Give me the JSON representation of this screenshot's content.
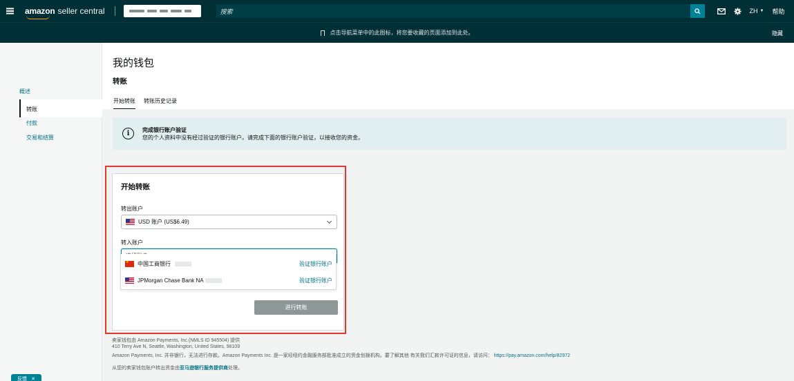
{
  "topbar": {
    "logo_amazon": "amazon",
    "logo_rest": "seller central",
    "search_placeholder": "搜索",
    "lang": "ZH",
    "help": "帮助"
  },
  "bookmark_bar": {
    "message": "点击导航菜单中的此图标，将您要收藏的页面添加到此处。",
    "hide": "隐藏"
  },
  "sidebar": {
    "items": [
      {
        "label": "概述"
      },
      {
        "label": "转账"
      },
      {
        "label": "付款"
      },
      {
        "label": "交易和结算"
      }
    ],
    "feedback": "反馈"
  },
  "page": {
    "title": "我的钱包",
    "section": "转账",
    "tabs": [
      {
        "label": "开始转账"
      },
      {
        "label": "转账历史记录"
      }
    ]
  },
  "alert": {
    "title": "完成银行账户验证",
    "body": "您的个人资料中没有经过验证的银行账户。请完成下面的银行账户验证，以接收您的资金。"
  },
  "transfer": {
    "title": "开始转账",
    "from_label": "转出账户",
    "from_value": "USD 账户 (US$6.49)",
    "to_label": "转入账户",
    "to_placeholder": "选择账户",
    "options": [
      {
        "name": "中国工商银行",
        "action": "验证银行账户"
      },
      {
        "name": "JPMorgan Chase Bank NA",
        "action": "验证银行账户"
      }
    ],
    "submit": "进行转账"
  },
  "footer": {
    "line1": "卖家钱包由 Amazon Payments, Inc.(NMLS ID 945504) 提供",
    "line2": "410 Terry Ave N, Seattle, Washington, United States, 98109",
    "line3": "Amazon Payments, Inc. 并非银行，无法进行存款。Amazon Payments Inc. 是一家经纽约金融服务部批准成立的资金划拨机构。要了解其他 有关我们汇款许可证的信息，请访问：",
    "line3_link": "https://pay.amazon.com/help/82972",
    "line4_pre": "从您的卖家钱包账户转出资金由",
    "line4_link": "亚马逊银行服务提供商",
    "line4_post": "处理。"
  }
}
